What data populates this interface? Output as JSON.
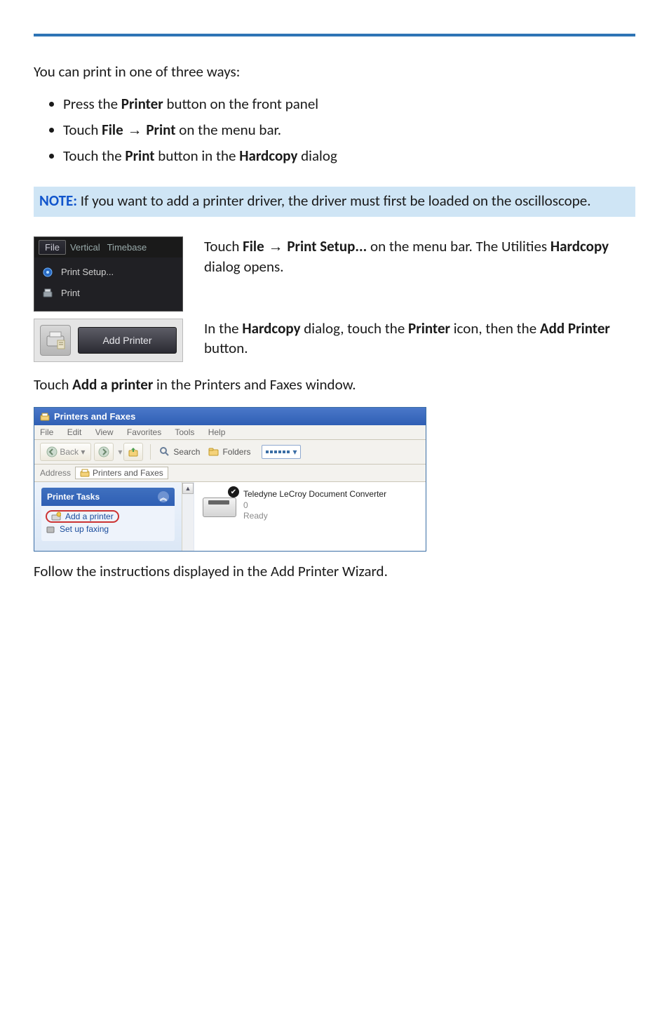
{
  "intro": "You can print in one of three ways:",
  "bullets": {
    "b1_a": "Press the ",
    "b1_b": "Printer",
    "b1_c": " button on the front panel",
    "b2_a": "Touch ",
    "b2_b": "File",
    "b2_arrow": " → ",
    "b2_c": "Print",
    "b2_d": " on the menu bar.",
    "b3_a": "Touch the ",
    "b3_b": "Print",
    "b3_c": " button in the ",
    "b3_d": "Hardcopy",
    "b3_e": " dialog"
  },
  "note": {
    "label": "NOTE:",
    "text": " If you want to add a printer driver, the driver must first be loaded on the oscilloscope."
  },
  "step1": {
    "a": "Touch ",
    "b": "File",
    "arrow": " → ",
    "c": "Print Setup...",
    "d": " on the menu bar. The Utilities ",
    "e": "Hardcopy",
    "f": " dialog opens."
  },
  "step2": {
    "a": "In the ",
    "b": "Hardcopy",
    "c": " dialog, touch the ",
    "d": "Printer",
    "e": " icon, then the ",
    "f": "Add Printer",
    "g": " button."
  },
  "step3": {
    "a": "Touch ",
    "b": "Add a printer",
    "c": " in the Printers and Faxes window."
  },
  "closing": "Follow the instructions displayed in the Add Printer Wizard.",
  "filemenu": {
    "file": "File",
    "vertical": "Vertical",
    "timebase": "Timebase",
    "printsetup": "Print Setup...",
    "print": "Print"
  },
  "addprinter_btn": "Add Printer",
  "pfwin": {
    "title": "Printers and Faxes",
    "menu": {
      "file": "File",
      "edit": "Edit",
      "view": "View",
      "fav": "Favorites",
      "tools": "Tools",
      "help": "Help"
    },
    "toolbar": {
      "back": "Back",
      "search": "Search",
      "folders": "Folders"
    },
    "addressLabel": "Address",
    "addressValue": "Printers and Faxes",
    "tasksHeader": "Printer Tasks",
    "task_add": "Add a printer",
    "task_fax": "Set up faxing",
    "printer_name": "Teledyne LeCroy Document Converter",
    "printer_jobs": "0",
    "printer_status": "Ready"
  }
}
